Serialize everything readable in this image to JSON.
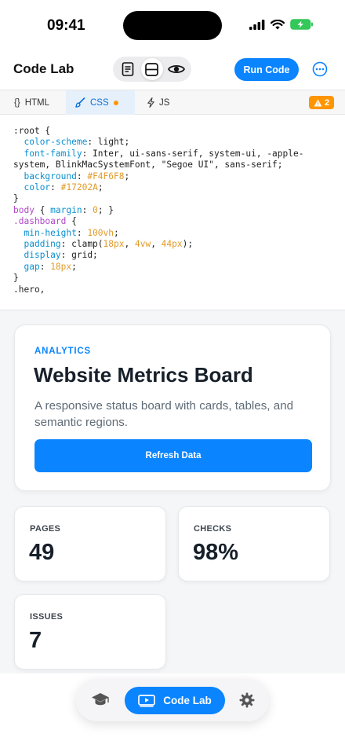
{
  "status_bar": {
    "time": "09:41"
  },
  "toolbar": {
    "title": "Code Lab",
    "run_label": "Run Code",
    "view_modes": [
      "document-icon",
      "split-icon",
      "eye-icon"
    ]
  },
  "tabs": [
    {
      "icon": "{}",
      "label": "HTML"
    },
    {
      "icon": "brush-icon",
      "label": "CSS",
      "modified": true
    },
    {
      "icon": "bolt-icon",
      "label": "JS"
    }
  ],
  "warnings": {
    "count": "2"
  },
  "code_lines": [
    [
      [
        ":root {",
        ""
      ]
    ],
    [
      [
        "  color-scheme",
        "prop"
      ],
      [
        ": light;",
        ""
      ]
    ],
    [
      [
        "  font-family",
        "prop"
      ],
      [
        ": Inter, ui-sans-serif, system-ui, -apple-system, BlinkMacSystemFont, \"Segoe UI\", sans-serif;",
        ""
      ]
    ],
    [
      [
        "  background",
        "prop"
      ],
      [
        ": ",
        ""
      ],
      [
        "#F4F6F8",
        "num"
      ],
      [
        ";",
        ""
      ]
    ],
    [
      [
        "  color",
        "prop"
      ],
      [
        ": ",
        ""
      ],
      [
        "#17202A",
        "num"
      ],
      [
        ";",
        ""
      ]
    ],
    [
      [
        "}",
        ""
      ]
    ],
    [
      [
        "body",
        "kw"
      ],
      [
        " { ",
        ""
      ],
      [
        "margin",
        "prop"
      ],
      [
        ": ",
        ""
      ],
      [
        "0",
        "num"
      ],
      [
        "; }",
        ""
      ]
    ],
    [
      [
        ".dashboard",
        "kw"
      ],
      [
        " {",
        ""
      ]
    ],
    [
      [
        "  min-height",
        "prop"
      ],
      [
        ": ",
        ""
      ],
      [
        "100vh",
        "num"
      ],
      [
        ";",
        ""
      ]
    ],
    [
      [
        "  padding",
        "prop"
      ],
      [
        ": clamp(",
        ""
      ],
      [
        "18px",
        "num"
      ],
      [
        ", ",
        ""
      ],
      [
        "4vw",
        "num"
      ],
      [
        ", ",
        ""
      ],
      [
        "44px",
        "num"
      ],
      [
        ");",
        ""
      ]
    ],
    [
      [
        "  display",
        "prop"
      ],
      [
        ": grid;",
        ""
      ]
    ],
    [
      [
        "  gap",
        "prop"
      ],
      [
        ": ",
        ""
      ],
      [
        "18px",
        "num"
      ],
      [
        ";",
        ""
      ]
    ],
    [
      [
        "}",
        ""
      ]
    ],
    [
      [
        ".hero,",
        ""
      ]
    ]
  ],
  "preview": {
    "hero": {
      "eyebrow": "ANALYTICS",
      "title": "Website Metrics Board",
      "description": "A responsive status board with cards, tables, and semantic regions.",
      "button": "Refresh Data"
    },
    "metrics": [
      {
        "label": "PAGES",
        "value": "49"
      },
      {
        "label": "CHECKS",
        "value": "98%"
      },
      {
        "label": "ISSUES",
        "value": "7"
      }
    ]
  },
  "bottom_nav": {
    "items": [
      "graduation-cap-icon",
      "Code Lab",
      "gear-icon"
    ],
    "active_label": "Code Lab"
  },
  "colors": {
    "accent": "#0a84ff",
    "warning": "#ff9500",
    "preview_bg": "#F4F6F8",
    "text": "#17202A"
  }
}
